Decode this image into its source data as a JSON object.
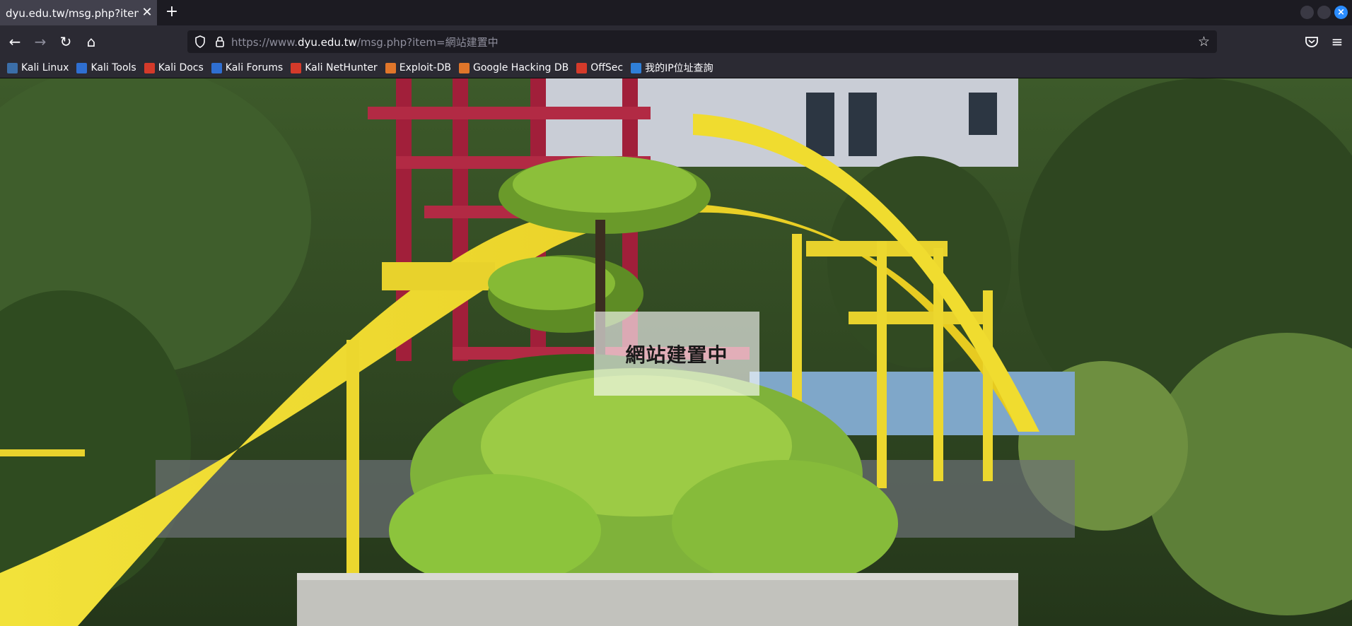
{
  "tab": {
    "title": "dyu.edu.tw/msg.php?item=網",
    "close": "✕"
  },
  "newtab": "+",
  "nav": {
    "back": "←",
    "forward": "→",
    "reload": "↻",
    "home": "⌂",
    "star": "☆",
    "menu": "≡"
  },
  "url": {
    "prefix": "https://www.",
    "host": "dyu.edu.tw",
    "path": "/msg.php?item=網站建置中"
  },
  "bookmarks": [
    {
      "label": "Kali Linux",
      "color": "#3b6ea8"
    },
    {
      "label": "Kali Tools",
      "color": "#2f6fd1"
    },
    {
      "label": "Kali Docs",
      "color": "#d43a2a"
    },
    {
      "label": "Kali Forums",
      "color": "#2f6fd1"
    },
    {
      "label": "Kali NetHunter",
      "color": "#d43a2a"
    },
    {
      "label": "Exploit-DB",
      "color": "#e0762a"
    },
    {
      "label": "Google Hacking DB",
      "color": "#e0762a"
    },
    {
      "label": "OffSec",
      "color": "#d43a2a"
    },
    {
      "label": "我的IP位址查詢",
      "color": "#2f7fd8"
    }
  ],
  "page": {
    "notice": "網站建置中"
  },
  "colors": {
    "accent": "#2a8cff",
    "chrome_dark": "#1c1b22",
    "chrome": "#2b2a33"
  }
}
